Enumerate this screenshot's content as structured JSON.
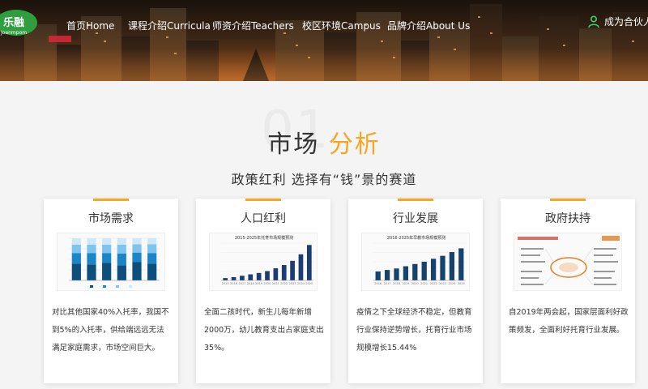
{
  "brand": {
    "logo_text": "乐融",
    "logo_sub": "Joenmpom",
    "color": "#2e9e3e"
  },
  "nav": {
    "items": [
      {
        "label": "首页Home"
      },
      {
        "label": "课程介绍Curricula"
      },
      {
        "label": "师资介绍Teachers"
      },
      {
        "label": "校区环境Campus"
      },
      {
        "label": "品牌介绍About Us"
      }
    ],
    "partner_label": "成为合伙人",
    "partner_icon": "user-icon"
  },
  "section": {
    "watermark": "01",
    "title_main": "市场",
    "title_accent": "分析",
    "subtitle": "政策红利 选择有“钱”景的赛道",
    "accent_color": "#f5a623"
  },
  "cards": [
    {
      "title": "市场需求",
      "desc": "对比其他国家40%入托率，我国不到5%的入托率，供给端远远无法满足家庭需求，市场空间巨大。",
      "chart_data": {
        "type": "bar",
        "categories": [
          "",
          "",
          "",
          "",
          "",
          ""
        ],
        "series": [
          {
            "values": [
              40,
              38,
              42,
              36,
              44,
              40
            ]
          },
          {
            "values": [
              25,
              27,
              23,
              28,
              22,
              25
            ]
          },
          {
            "values": [
              20,
              20,
              20,
              21,
              20,
              21
            ]
          },
          {
            "values": [
              15,
              15,
              15,
              15,
              14,
              14
            ]
          }
        ],
        "ylim": [
          0,
          100
        ]
      }
    },
    {
      "title": "人口红利",
      "desc": "全面二孩时代，新生儿每年新增2000万，幼儿教育支出占家庭支出35%。",
      "chart_data": {
        "type": "bar",
        "title": "2015-2025年托育市场规模预测",
        "categories": [
          "2015",
          "2016",
          "2017",
          "2018",
          "2019",
          "2020",
          "2021",
          "2022",
          "2023",
          "2024",
          "2025"
        ],
        "values": [
          500,
          700,
          1000,
          1300,
          1600,
          2000,
          2600,
          3300,
          4200,
          5600,
          7600
        ],
        "ylim": [
          0,
          8000
        ]
      }
    },
    {
      "title": "行业发展",
      "desc": "疫情之下全球经济不稳定，但教育行业保持逆势增长，托育行业市场规模增长15.44%",
      "chart_data": {
        "type": "bar",
        "title": "2016-2025年早教市场规模预测",
        "categories": [
          "2016",
          "2017",
          "2018",
          "2019",
          "2020",
          "2021",
          "2022",
          "2023",
          "2024",
          "2025"
        ],
        "values": [
          1200,
          1400,
          1600,
          1900,
          2200,
          2500,
          2900,
          3300,
          3800,
          4300
        ],
        "ylim": [
          0,
          5000
        ]
      }
    },
    {
      "title": "政府扶持",
      "desc": "自2019年两会起，国家层面利好政策频发，全面利好托育行业发展。"
    }
  ]
}
